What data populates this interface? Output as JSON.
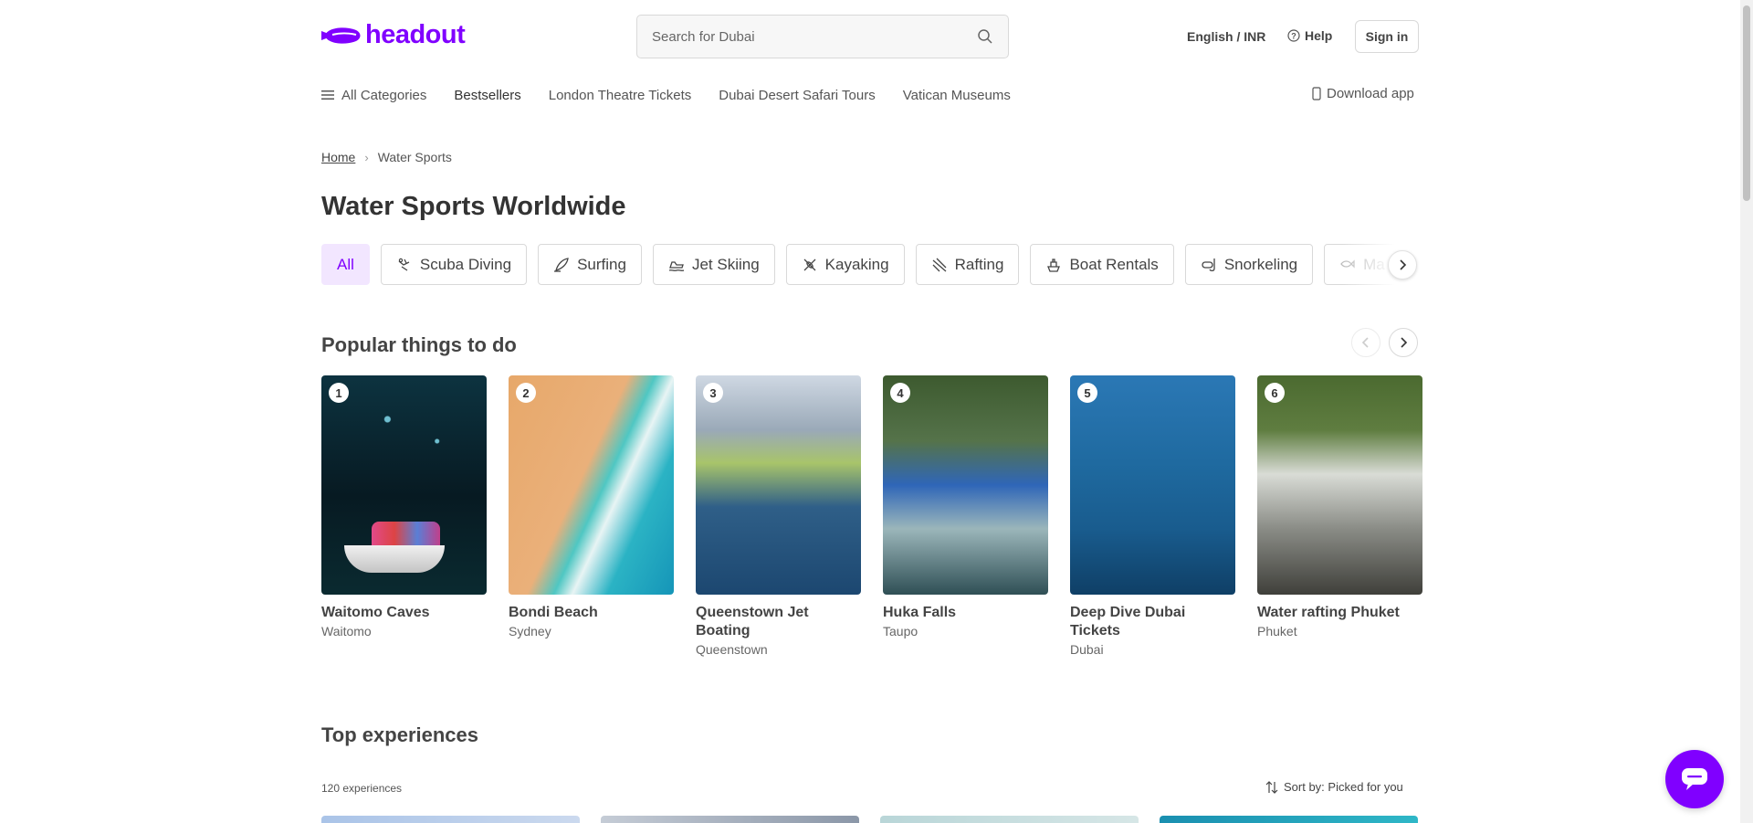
{
  "brand": {
    "name": "headout",
    "color": "#8000ff"
  },
  "header": {
    "search_placeholder": "Search for Dubai",
    "language_currency": "English / INR",
    "help_label": "Help",
    "signin_label": "Sign in"
  },
  "nav": {
    "all_categories": "All Categories",
    "items": [
      "Bestsellers",
      "London Theatre Tickets",
      "Dubai Desert Safari Tours",
      "Vatican Museums"
    ],
    "download_app": "Download app"
  },
  "breadcrumb": {
    "home": "Home",
    "current": "Water Sports"
  },
  "page_title": "Water Sports Worldwide",
  "categories": [
    {
      "label": "All",
      "icon": "none"
    },
    {
      "label": "Scuba Diving",
      "icon": "scuba-icon"
    },
    {
      "label": "Surfing",
      "icon": "surfboard-icon"
    },
    {
      "label": "Jet Skiing",
      "icon": "jetski-icon"
    },
    {
      "label": "Kayaking",
      "icon": "kayak-icon"
    },
    {
      "label": "Rafting",
      "icon": "raft-icon"
    },
    {
      "label": "Boat Rentals",
      "icon": "boat-icon"
    },
    {
      "label": "Snorkeling",
      "icon": "snorkel-icon"
    },
    {
      "label": "Ma",
      "icon": "marine-icon"
    }
  ],
  "popular": {
    "title": "Popular things to do",
    "items": [
      {
        "rank": "1",
        "name": "Waitomo Caves",
        "city": "Waitomo"
      },
      {
        "rank": "2",
        "name": "Bondi Beach",
        "city": "Sydney"
      },
      {
        "rank": "3",
        "name": "Queenstown Jet Boating",
        "city": "Queenstown"
      },
      {
        "rank": "4",
        "name": "Huka Falls",
        "city": "Taupo"
      },
      {
        "rank": "5",
        "name": "Deep Dive Dubai Tickets",
        "city": "Dubai"
      },
      {
        "rank": "6",
        "name": "Water rafting Phuket",
        "city": "Phuket"
      }
    ]
  },
  "top_experiences": {
    "title": "Top experiences",
    "count": "120 experiences",
    "sort_label": "Sort by: Picked for you"
  }
}
